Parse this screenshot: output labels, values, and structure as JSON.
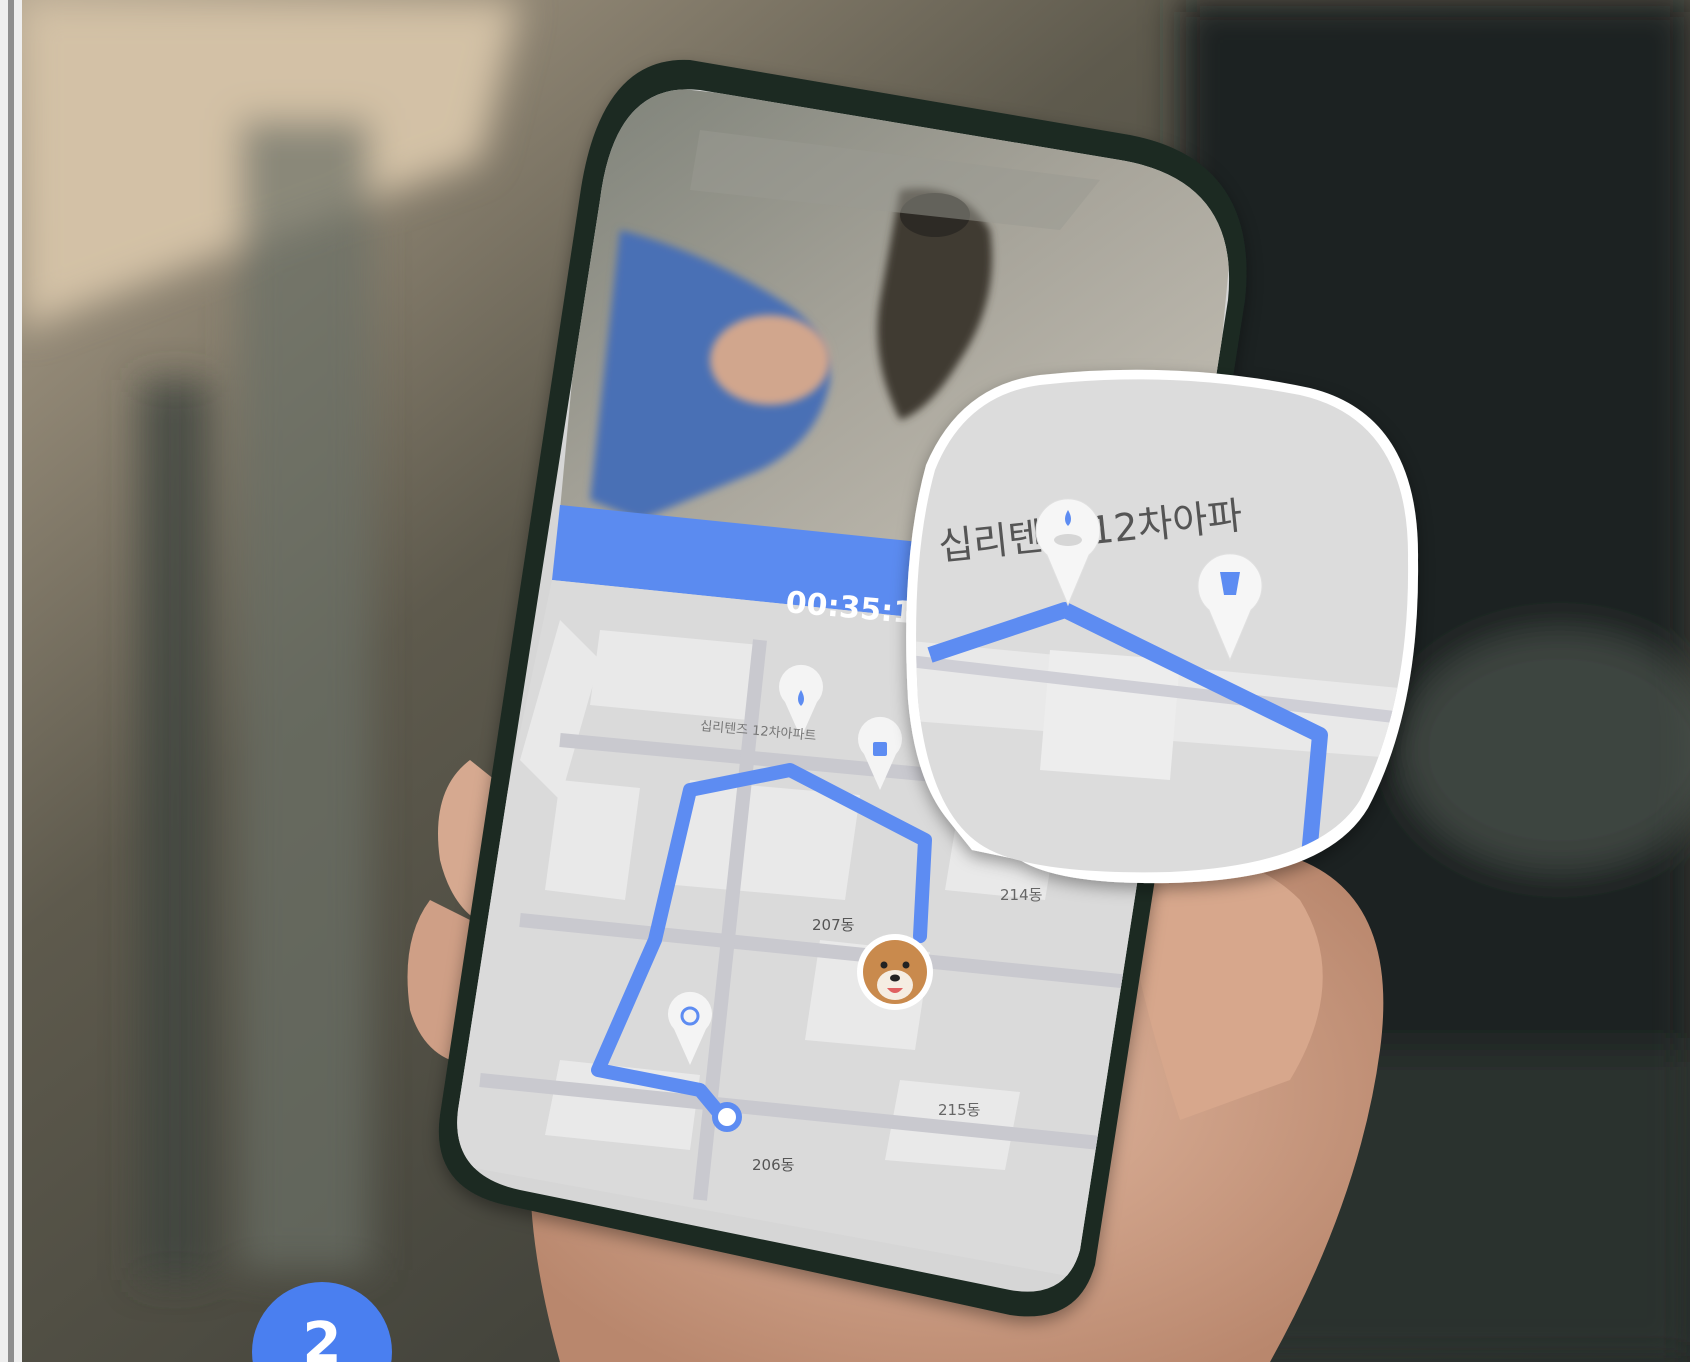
{
  "timer": {
    "text": "00:35:1"
  },
  "map": {
    "place_label": "십리텐즈 12차아파트",
    "zoom_label": "십리텐즈 12차아파",
    "buildings": [
      "207동",
      "214동",
      "215동",
      "206동"
    ]
  },
  "markers": {
    "water_icon": "water-drop-icon",
    "cup_icon": "cup-icon",
    "poop_icon": "poop-icon",
    "dog_avatar": "dog-avatar-icon"
  },
  "step_badge": {
    "number": "2"
  },
  "colors": {
    "accent": "#5b8bf0",
    "route": "#5d8cf2",
    "map_bg": "#d9d9d9",
    "badge": "#4a7ff0"
  }
}
